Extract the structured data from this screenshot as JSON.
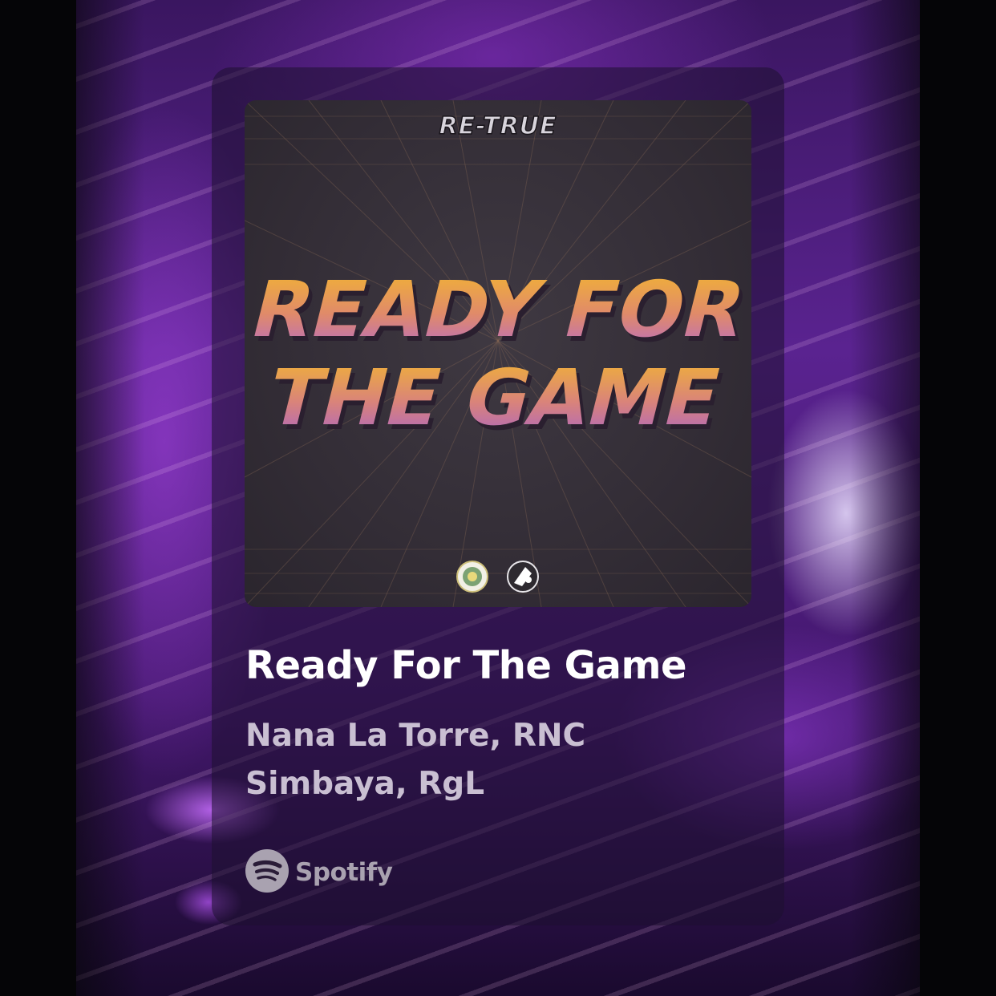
{
  "cover": {
    "label_top": "RE-TRUE",
    "title_line1": "READY FOR",
    "title_line2": "THE GAME"
  },
  "track": {
    "title": "Ready For The Game",
    "artists": "Nana La Torre, RNC Simbaya, RgL"
  },
  "brand": {
    "name": "Spotify",
    "icon": "spotify-icon"
  },
  "colors": {
    "title_gradient_top": "#f3b72f",
    "title_gradient_bottom": "#b56ac9",
    "card_text": "#ffffff",
    "artist_text": "#c9bfd2",
    "brand_text": "#a9a2b0"
  }
}
